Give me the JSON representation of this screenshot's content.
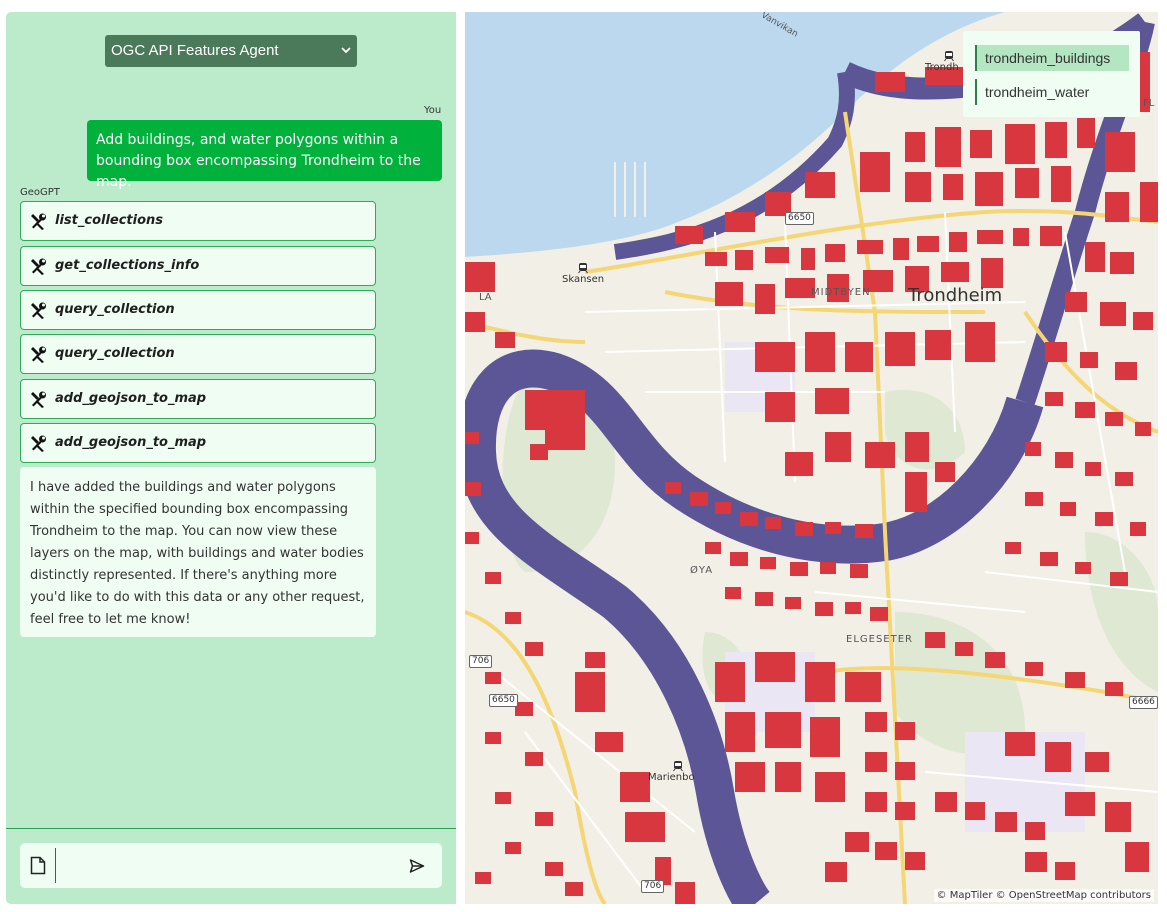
{
  "agent_select": {
    "selected": "OGC API Features Agent"
  },
  "chat": {
    "user_label": "You",
    "user_message": "Add buildings, and water polygons within a bounding box encompassing Trondheim to the map.",
    "assistant_label": "GeoGPT",
    "tool_calls": [
      {
        "name": "list_collections",
        "icon": "tools-icon"
      },
      {
        "name": "get_collections_info",
        "icon": "tools-icon"
      },
      {
        "name": "query_collection",
        "icon": "tools-icon"
      },
      {
        "name": "query_collection",
        "icon": "tools-icon"
      },
      {
        "name": "add_geojson_to_map",
        "icon": "tools-icon"
      },
      {
        "name": "add_geojson_to_map",
        "icon": "tools-icon"
      }
    ],
    "assistant_message": "I have added the buildings and water polygons within the specified bounding box encompassing Trondheim to the map. You can now view these layers on the map, with buildings and water bodies distinctly represented. If there's anything more you'd like to do with this data or any other request, feel free to let me know!"
  },
  "input": {
    "value": "",
    "attach_icon": "file-icon",
    "send_icon": "send-icon"
  },
  "map": {
    "layers": [
      {
        "name": "trondheim_buildings",
        "active": true
      },
      {
        "name": "trondheim_water",
        "active": false
      }
    ],
    "labels": {
      "city": "Trondheim",
      "midtbyen": "MIDTBYEN",
      "skansen": "Skansen",
      "oya": "ØYA",
      "elgeseter": "ELGESETER",
      "marienborg": "Marienbo",
      "vanvikan": "Vanvikan",
      "trondheim_station": "Trondh",
      "la": "LA",
      "fl": "FL"
    },
    "road_numbers": [
      "6650",
      "706",
      "6650",
      "706",
      "6666"
    ],
    "attribution": "© MapTiler © OpenStreetMap contributors"
  },
  "colors": {
    "panel_bg": "#bcebcb",
    "user_bubble": "#00b13c",
    "bubble_bg": "#effdf3",
    "select_bg": "#4a7a5a",
    "water_sea": "#bcd8ef",
    "river": "#5c5596",
    "buildings": "#d9373f",
    "land": "#f2efe6"
  }
}
